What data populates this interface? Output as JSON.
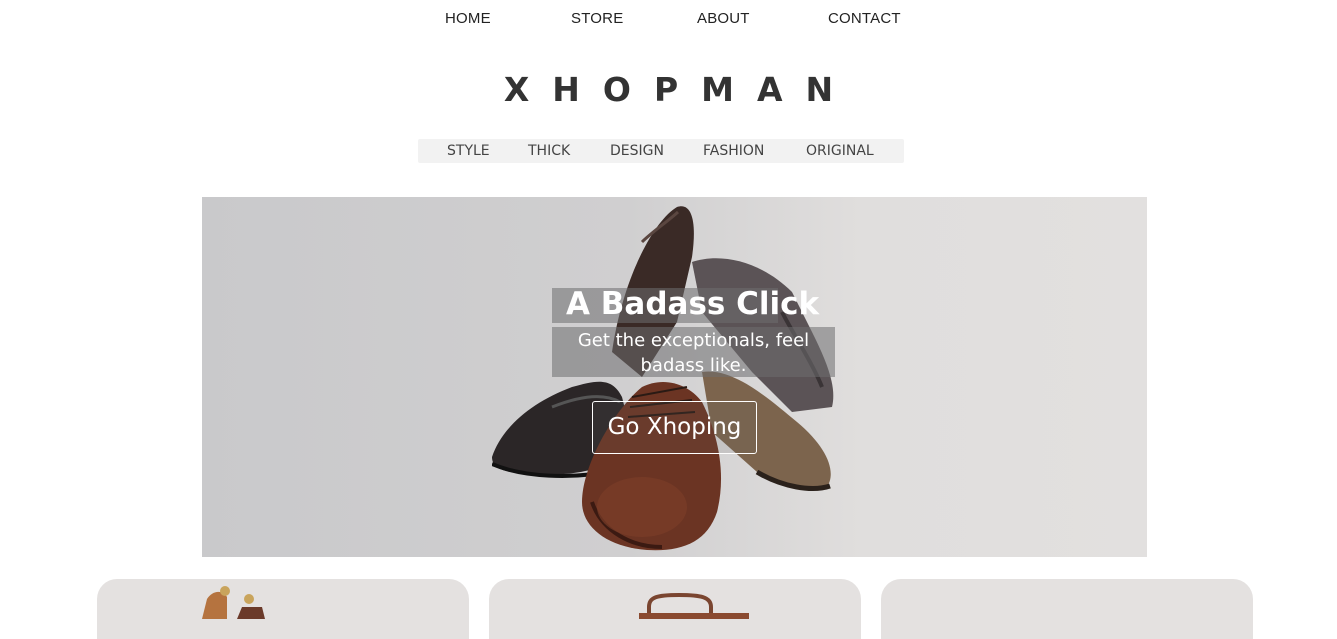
{
  "top_nav": {
    "items": [
      "HOME",
      "STORE",
      "ABOUT",
      "CONTACT"
    ]
  },
  "brand": {
    "name": "XHOPMAN"
  },
  "category_bar": {
    "items": [
      "STYLE",
      "THICK",
      "DESIGN",
      "FASHION",
      "ORIGINAL"
    ]
  },
  "hero": {
    "title": "A Badass Click",
    "subtitle": "Get the exceptionals, feel badass like.",
    "button_label": "Go Xhoping"
  },
  "product_cards": [
    {
      "image": "shoe-trees-image"
    },
    {
      "image": "leather-bag-image"
    },
    {
      "image": "product-image"
    }
  ],
  "colors": {
    "background": "#ffffff",
    "text": "#333333",
    "hero_bg": "#d0cfd0",
    "category_bar_bg": "#f2f2f2",
    "card_bg": "#e4e1e0"
  }
}
